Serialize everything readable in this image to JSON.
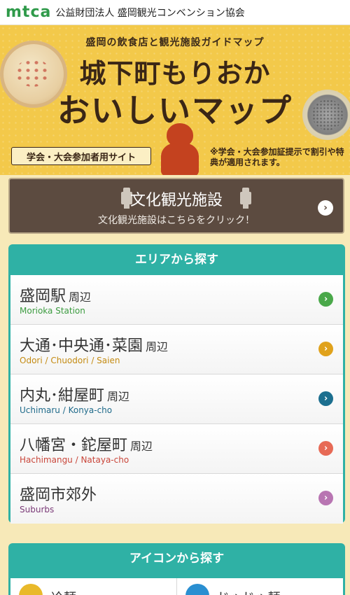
{
  "header": {
    "logo_text": "mtca",
    "org_name": "公益財団法人 盛岡観光コンベンション協会"
  },
  "hero": {
    "subtitle": "盛岡の飲食店と観光施設ガイドマップ",
    "title_line1": "城下町もりおか",
    "title_line2": "おいしいマップ",
    "badge": "学会・大会参加者用サイト",
    "note": "※学会・大会参加証提示で割引や特典が適用されます。"
  },
  "culture": {
    "title": "文化観光施設",
    "subtitle": "文化観光施設はこちらをクリック！"
  },
  "area_search": {
    "heading": "エリアから探す",
    "items": [
      {
        "name": "盛岡駅",
        "suffix": "周辺",
        "roman": "Morioka Station",
        "color": "#3b9b3f",
        "chevron_color": "#4aa84a"
      },
      {
        "name": "大通･中央通･菜園",
        "suffix": "周辺",
        "roman": "Odori / Chuodori / Saien",
        "color": "#c48b12",
        "chevron_color": "#e0a21c"
      },
      {
        "name": "内丸･紺屋町",
        "suffix": "周辺",
        "roman": "Uchimaru / Konya-cho",
        "color": "#1f6a8a",
        "chevron_color": "#1c6f8f"
      },
      {
        "name": "八幡宮・鉈屋町",
        "suffix": "周辺",
        "roman": "Hachimangu / Nataya-cho",
        "color": "#c9463a",
        "chevron_color": "#e76a56"
      },
      {
        "name": "盛岡市郊外",
        "suffix": "",
        "roman": "Suburbs",
        "color": "#7b3b78",
        "chevron_color": "#b875b2"
      }
    ]
  },
  "icon_search": {
    "heading": "アイコンから探す",
    "items": [
      {
        "label": "冷麺",
        "icon": "reimen-icon",
        "color": "#e9b92a"
      },
      {
        "label": "じゃじゃ麺",
        "icon": "jajamen-icon",
        "color": "#2a8fd1"
      }
    ]
  }
}
